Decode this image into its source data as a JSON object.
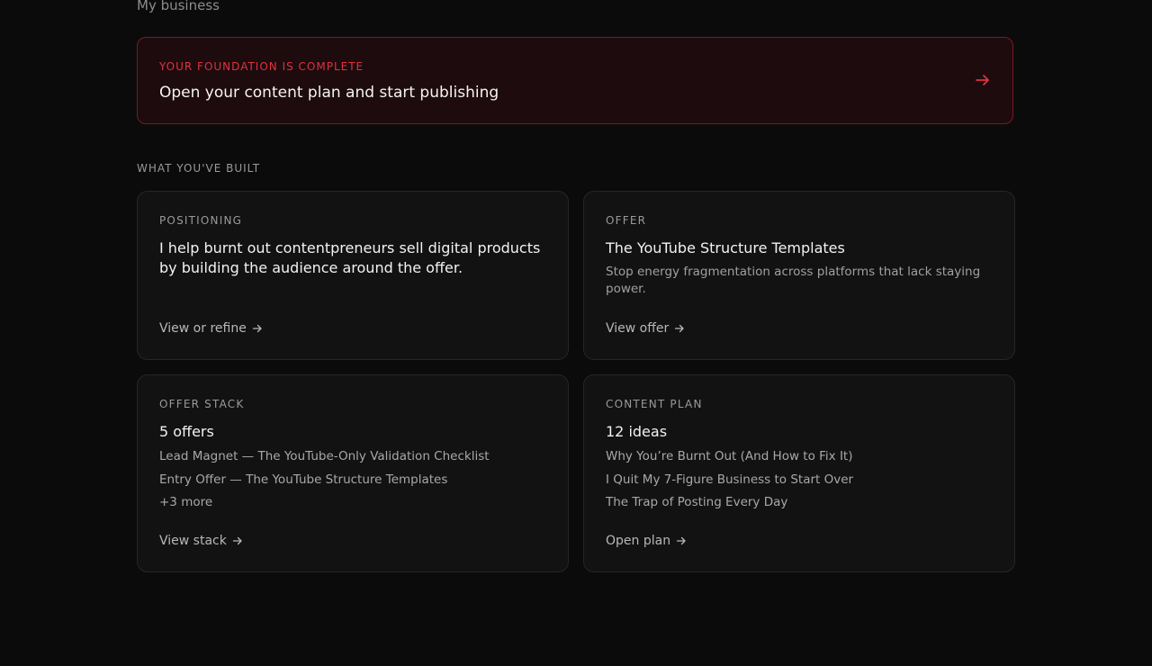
{
  "page": {
    "heading": "My business"
  },
  "cta": {
    "eyebrow": "YOUR FOUNDATION IS COMPLETE",
    "title": "Open your content plan and start publishing",
    "icon": "arrow-right-icon",
    "accent_color": "#e0323f"
  },
  "section": {
    "label": "WHAT YOU'VE BUILT"
  },
  "cards": {
    "positioning": {
      "eyebrow": "POSITIONING",
      "title": "I help burnt out contentpreneurs sell digital products by building the audience around the offer.",
      "link": "View or refine"
    },
    "offer": {
      "eyebrow": "OFFER",
      "title": "The YouTube Structure Templates",
      "subtitle": "Stop energy fragmentation across platforms that lack staying power.",
      "link": "View offer"
    },
    "offer_stack": {
      "eyebrow": "OFFER STACK",
      "title": "5 offers",
      "items": [
        "Lead Magnet — The YouTube-Only Validation Checklist",
        "Entry Offer — The YouTube Structure Templates"
      ],
      "more": "+3 more",
      "link": "View stack"
    },
    "content_plan": {
      "eyebrow": "CONTENT PLAN",
      "title": "12 ideas",
      "items": [
        "Why You’re Burnt Out (And How to Fix It)",
        "I Quit My 7-Figure Business to Start Over",
        "The Trap of Posting Every Day"
      ],
      "link": "Open plan"
    }
  }
}
